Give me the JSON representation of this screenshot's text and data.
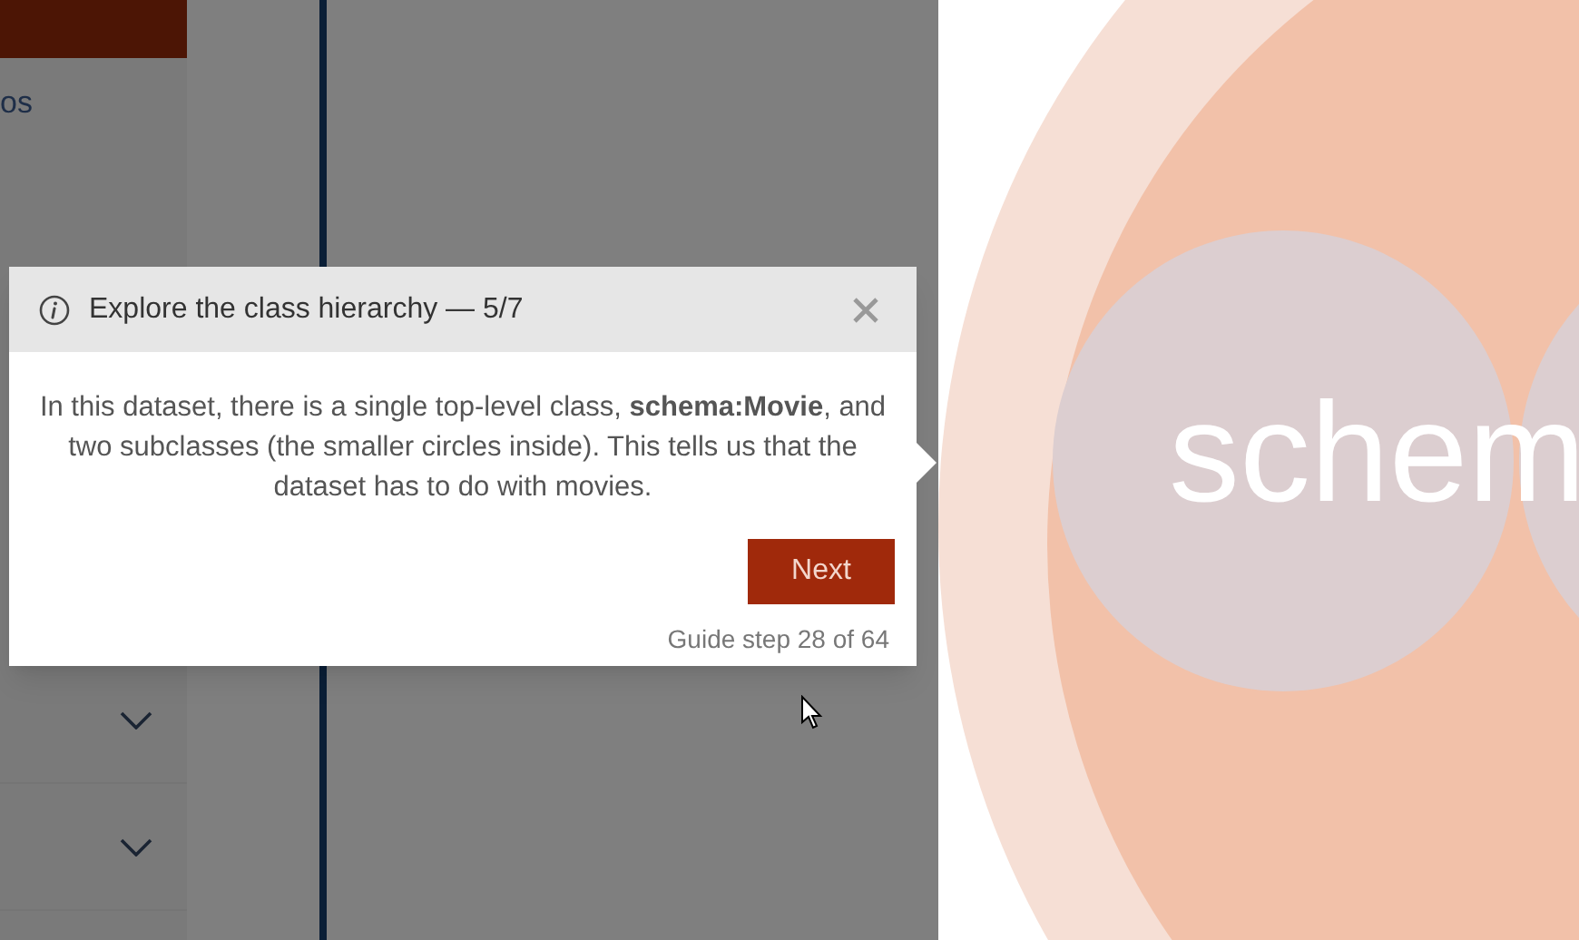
{
  "sidebar": {
    "label": "os",
    "sections": [
      {
        "expanded": false
      },
      {
        "expanded": false
      }
    ]
  },
  "tour": {
    "title": "Explore the class hierarchy — 5/7",
    "body": "In this dataset, there is a single top-level class, **schema:Movie**, and two subclasses (the smaller circles inside). This tells us that the dataset has to do with movies.",
    "next": "Next",
    "progress": "Guide step 28 of 64"
  },
  "chart": {
    "label": "schem"
  }
}
